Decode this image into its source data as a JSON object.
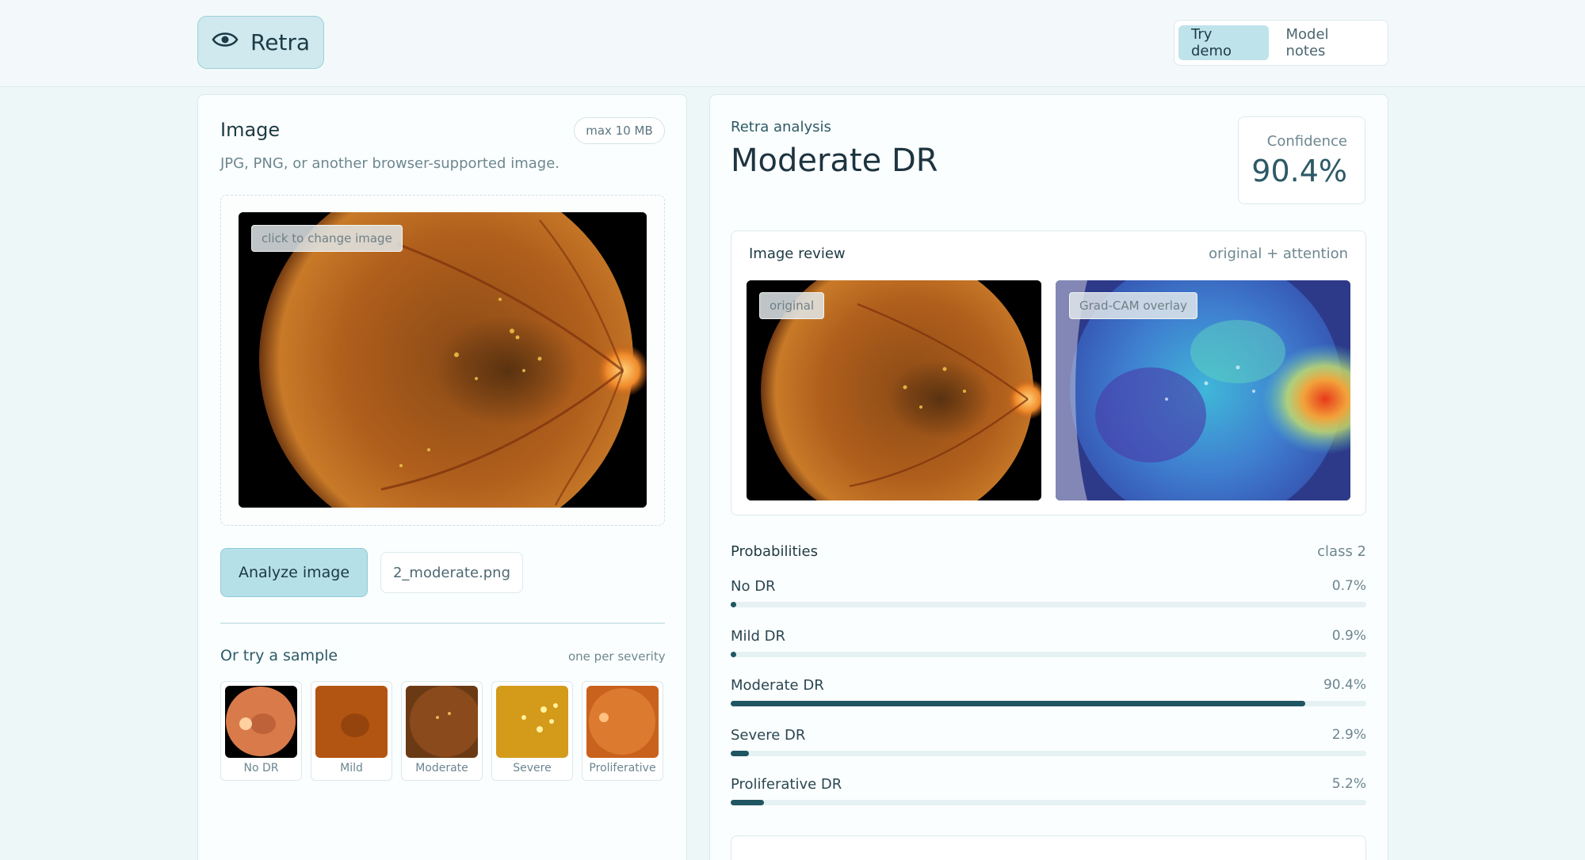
{
  "app": {
    "name": "Retra"
  },
  "nav": {
    "tabs": [
      {
        "label": "Try demo",
        "active": true
      },
      {
        "label": "Model notes",
        "active": false
      }
    ]
  },
  "upload": {
    "title": "Image",
    "size_badge": "max 10 MB",
    "hint": "JPG, PNG, or another browser-supported image.",
    "change_tag": "click to change image",
    "analyze_button": "Analyze image",
    "file_name": "2_moderate.png"
  },
  "samples": {
    "title": "Or try a sample",
    "note": "one per severity",
    "items": [
      {
        "label": "No DR"
      },
      {
        "label": "Mild"
      },
      {
        "label": "Moderate"
      },
      {
        "label": "Severe"
      },
      {
        "label": "Proliferative"
      }
    ]
  },
  "analysis": {
    "kicker": "Retra analysis",
    "result": "Moderate DR",
    "confidence_label": "Confidence",
    "confidence_value": "90.4%"
  },
  "review": {
    "title": "Image review",
    "note": "original + attention",
    "original_tag": "original",
    "overlay_tag": "Grad-CAM overlay"
  },
  "probabilities": {
    "title": "Probabilities",
    "note": "class 2",
    "rows": [
      {
        "label": "No DR",
        "value": "0.7%",
        "fraction": 0.007
      },
      {
        "label": "Mild DR",
        "value": "0.9%",
        "fraction": 0.009
      },
      {
        "label": "Moderate DR",
        "value": "90.4%",
        "fraction": 0.904
      },
      {
        "label": "Severe DR",
        "value": "2.9%",
        "fraction": 0.029
      },
      {
        "label": "Proliferative DR",
        "value": "5.2%",
        "fraction": 0.052
      }
    ]
  },
  "colors": {
    "accent": "#1f5662",
    "brand_bg": "#cfe9ee",
    "button_bg": "#b6e0e8"
  },
  "icons": {
    "brand": "eye-icon"
  }
}
